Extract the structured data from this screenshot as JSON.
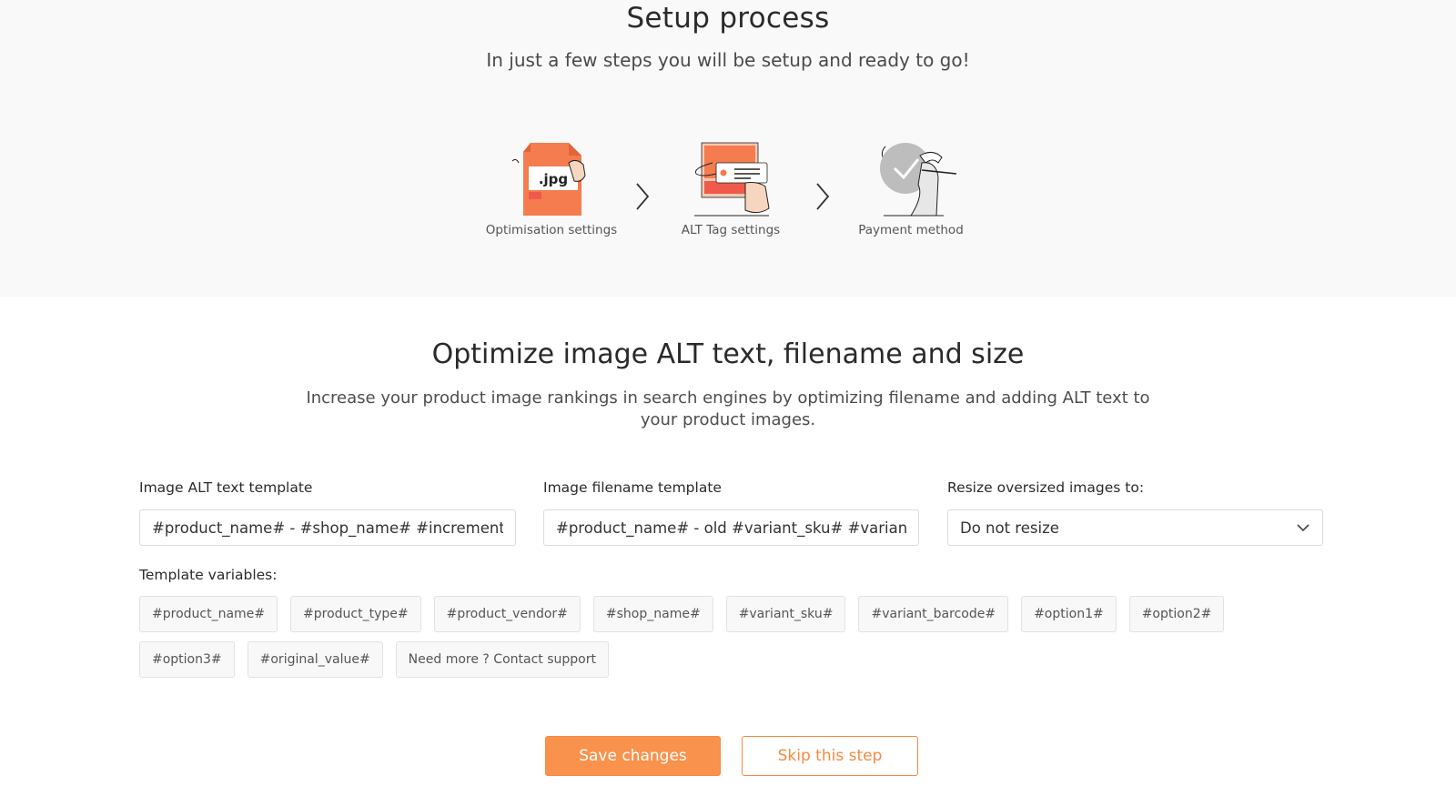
{
  "header": {
    "title": "Setup process",
    "subtitle": "In just a few steps you will be setup and ready to go!"
  },
  "steps": [
    {
      "label": "Optimisation settings",
      "icon": "jpg-file-icon",
      "badge": ".jpg"
    },
    {
      "label": "ALT Tag settings",
      "icon": "tag-card-icon"
    },
    {
      "label": "Payment method",
      "icon": "checkmark-hand-icon"
    }
  ],
  "main": {
    "heading": "Optimize image ALT text, filename and size",
    "description": "Increase your product image rankings in search engines by optimizing filename and adding ALT text to your product images."
  },
  "form": {
    "alt_label": "Image ALT text template",
    "alt_value": "#product_name# - #shop_name# #increment#",
    "filename_label": "Image filename template",
    "filename_value": "#product_name# - old #variant_sku# #variant_barcode#",
    "resize_label": "Resize oversized images to:",
    "resize_value": "Do not resize"
  },
  "template_variables": {
    "label": "Template variables:",
    "chips": [
      "#product_name#",
      "#product_type#",
      "#product_vendor#",
      "#shop_name#",
      "#variant_sku#",
      "#variant_barcode#",
      "#option1#",
      "#option2#",
      "#option3#",
      "#original_value#",
      "Need more ? Contact support"
    ]
  },
  "actions": {
    "save_label": "Save changes",
    "skip_label": "Skip this step"
  },
  "colors": {
    "accent": "#f9924c",
    "illustration_orange": "#f47c4f",
    "illustration_red": "#ef5a4a",
    "header_bg": "#f9f9f9"
  }
}
